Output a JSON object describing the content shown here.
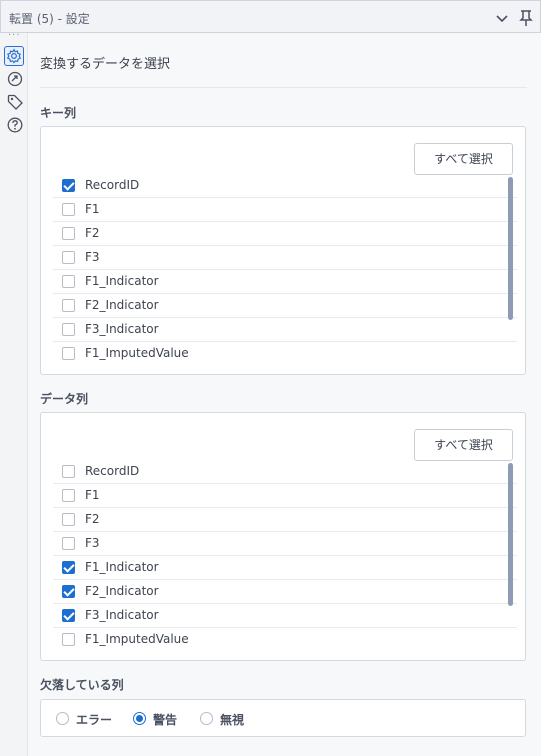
{
  "window": {
    "title": "転置 (5) - 設定"
  },
  "sidebar": {
    "more": "···",
    "icons": [
      "gear-icon",
      "connections-icon",
      "tag-icon",
      "help-icon"
    ]
  },
  "main": {
    "heading": "変換するデータを選択"
  },
  "key_columns": {
    "label": "キー列",
    "select_all": "すべて選択",
    "items": [
      {
        "label": "RecordID",
        "checked": true
      },
      {
        "label": "F1",
        "checked": false
      },
      {
        "label": "F2",
        "checked": false
      },
      {
        "label": "F3",
        "checked": false
      },
      {
        "label": "F1_Indicator",
        "checked": false
      },
      {
        "label": "F2_Indicator",
        "checked": false
      },
      {
        "label": "F3_Indicator",
        "checked": false
      },
      {
        "label": "F1_ImputedValue",
        "checked": false
      }
    ]
  },
  "data_columns": {
    "label": "データ列",
    "select_all": "すべて選択",
    "items": [
      {
        "label": "RecordID",
        "checked": false
      },
      {
        "label": "F1",
        "checked": false
      },
      {
        "label": "F2",
        "checked": false
      },
      {
        "label": "F3",
        "checked": false
      },
      {
        "label": "F1_Indicator",
        "checked": true
      },
      {
        "label": "F2_Indicator",
        "checked": true
      },
      {
        "label": "F3_Indicator",
        "checked": true
      },
      {
        "label": "F1_ImputedValue",
        "checked": false
      }
    ]
  },
  "missing_columns": {
    "label": "欠落している列",
    "options": [
      {
        "label": "エラー",
        "selected": false
      },
      {
        "label": "警告",
        "selected": true
      },
      {
        "label": "無視",
        "selected": false
      }
    ]
  },
  "colors": {
    "accent": "#1a6fd1",
    "scrollbar": "#8e9bb4"
  }
}
